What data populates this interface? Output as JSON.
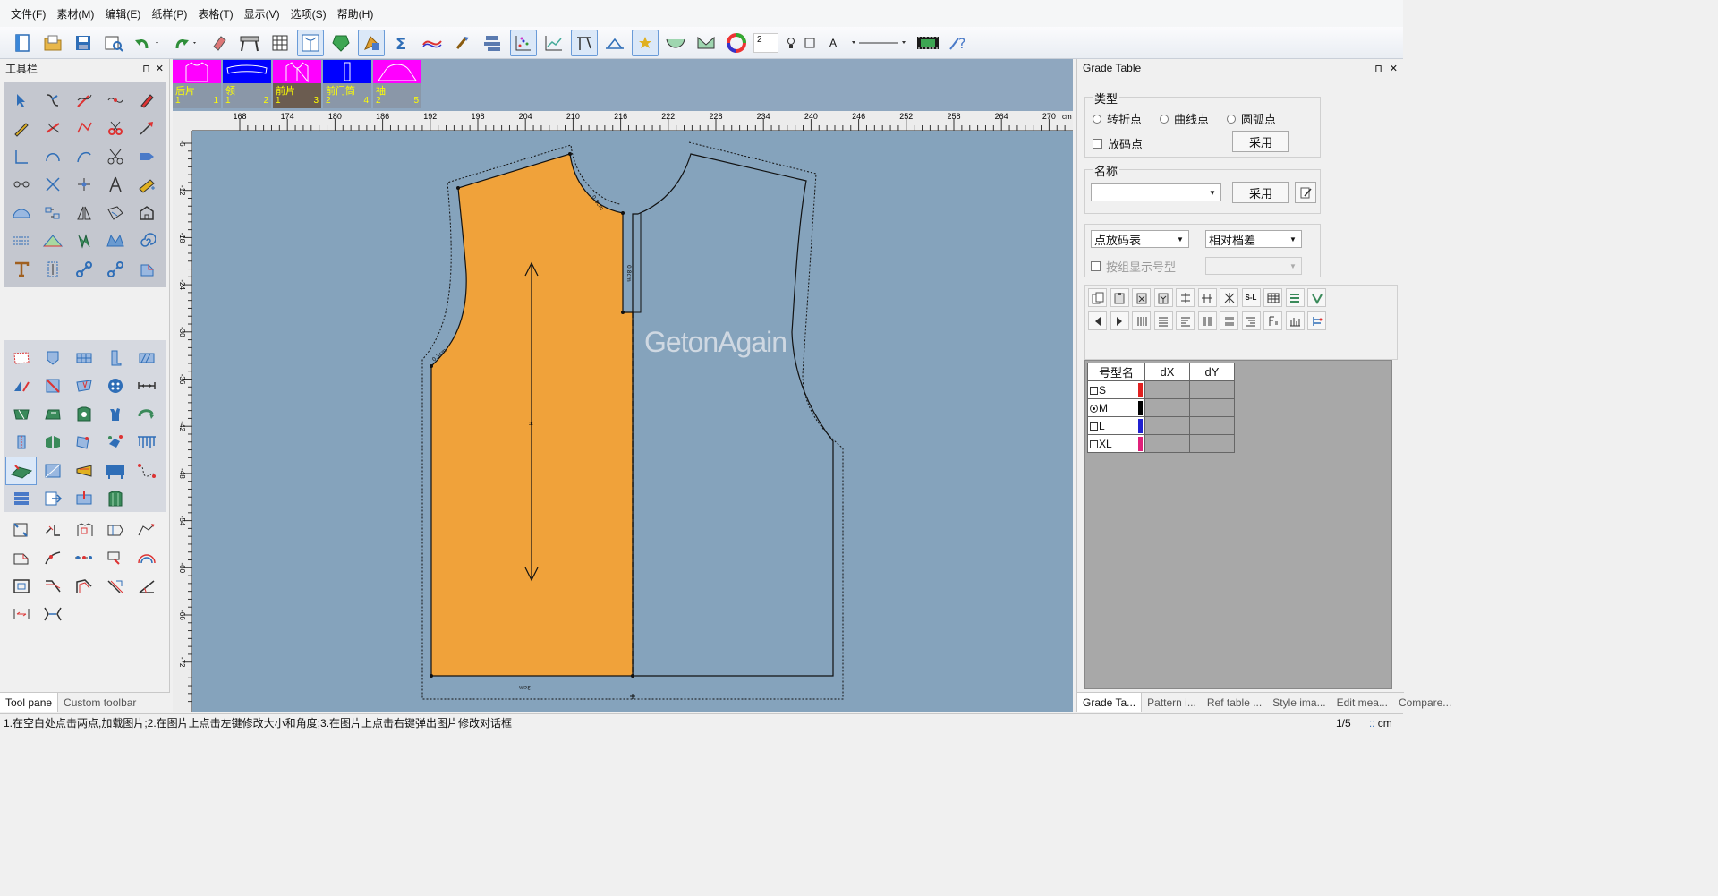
{
  "menu": [
    "文件(F)",
    "素材(M)",
    "编辑(E)",
    "纸样(P)",
    "表格(T)",
    "显示(V)",
    "选项(S)",
    "帮助(H)"
  ],
  "toolbar": {
    "icons": [
      "new-file-icon",
      "open-file-icon",
      "save-icon",
      "print-preview-icon",
      "undo-icon",
      "redo-icon",
      "eraser-icon",
      "plotter-icon",
      "grid-icon",
      "piece-view-icon",
      "piece-fill-icon",
      "lock-icon",
      "sigma-icon",
      "curve-icon",
      "brush-icon",
      "layers-icon",
      "points-icon",
      "graph-icon",
      "measure-tool-icon",
      "ruler-icon",
      "star-icon",
      "bowl-icon",
      "cup-icon",
      "color-wheel-icon"
    ],
    "line_width": "2",
    "text_label": "A",
    "help_icon": "help-icon"
  },
  "toolpanel": {
    "title": "工具栏",
    "pin": "⊓",
    "close": "✕",
    "tabs": [
      "Tool pane",
      "Custom toolbar"
    ]
  },
  "pieces": [
    {
      "name": "后片",
      "left": "1",
      "right": "1",
      "color": "#ff00ff"
    },
    {
      "name": "领",
      "left": "1",
      "right": "2",
      "color": "#0000ff"
    },
    {
      "name": "前片",
      "left": "1",
      "right": "3",
      "color": "#ff00ff"
    },
    {
      "name": "前门筒",
      "left": "2",
      "right": "4",
      "color": "#0000ff"
    },
    {
      "name": "袖",
      "left": "2",
      "right": "5",
      "color": "#ff00ff"
    }
  ],
  "ruler": {
    "h_labels": [
      "168",
      "174",
      "180",
      "186",
      "192",
      "198",
      "204",
      "210",
      "216",
      "222",
      "228",
      "234",
      "240",
      "246",
      "252",
      "258",
      "264",
      "270"
    ],
    "unit": "cm",
    "v_labels": [
      "-6",
      "-12",
      "-18",
      "-24",
      "-30",
      "-36",
      "-42",
      "-48",
      "-54",
      "-60",
      "-66",
      "-72"
    ]
  },
  "canvas": {
    "watermark": "GetonAgain",
    "piece_fill": "#f0a23a",
    "seam_label_1": "0.3cm",
    "seam_label_2": "0.8cm",
    "hem_label": "3cm"
  },
  "grade": {
    "title": "Grade Table",
    "type_legend": "类型",
    "types": [
      "转折点",
      "曲线点",
      "圆弧点"
    ],
    "grade_point": "放码点",
    "apply": "采用",
    "name_legend": "名称",
    "name_value": "",
    "table_mode": "点放码表",
    "diff_mode": "相对档差",
    "group_display": "按组显示号型",
    "col_size": "号型名",
    "col_dx": "dX",
    "col_dy": "dY",
    "sizes": [
      {
        "name": "S",
        "color": "#e02020",
        "selected": false
      },
      {
        "name": "M",
        "color": "#000000",
        "selected": true
      },
      {
        "name": "L",
        "color": "#2020d0",
        "selected": false
      },
      {
        "name": "XL",
        "color": "#e0207a",
        "selected": false
      }
    ],
    "tabs": [
      "Grade Ta...",
      "Pattern i...",
      "Ref table ...",
      "Style ima...",
      "Edit mea...",
      "Compare..."
    ]
  },
  "status": {
    "hint": "1.在空白处点击两点,加载图片;2.在图片上点击左键修改大小和角度;3.在图片上点击右键弹出图片修改对话框",
    "page": "1/5",
    "unit": "cm"
  }
}
